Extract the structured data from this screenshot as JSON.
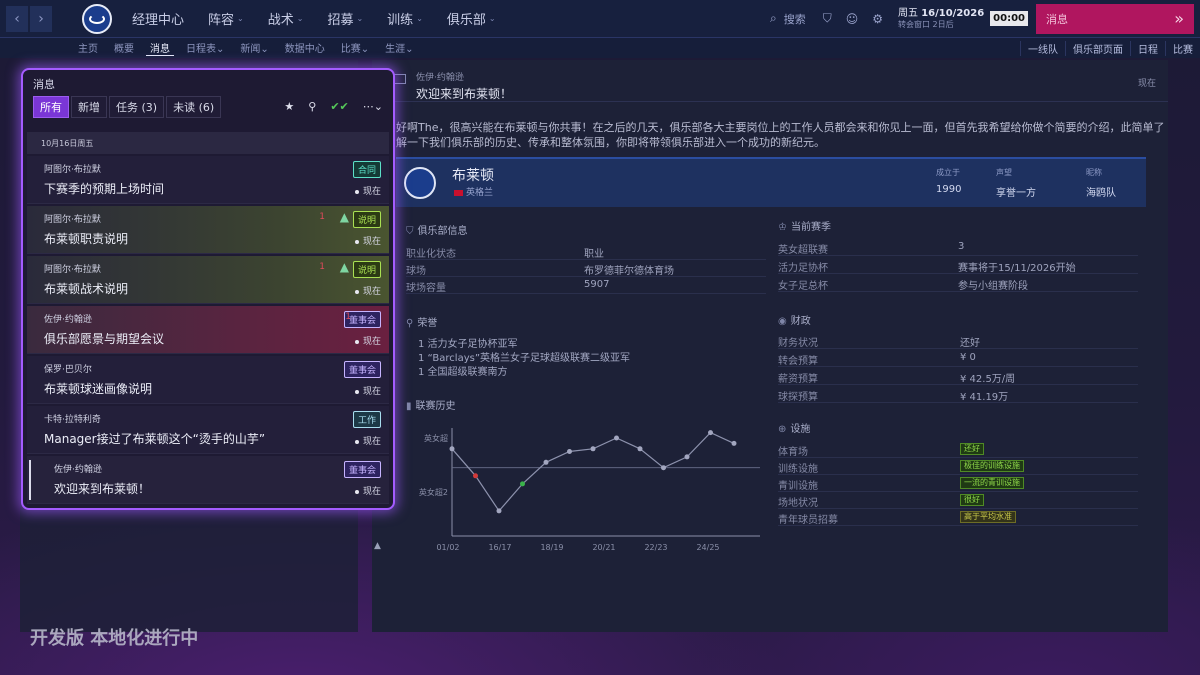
{
  "topnav": {
    "items": [
      "经理中心",
      "阵容",
      "战术",
      "招募",
      "训练",
      "俱乐部"
    ],
    "search_label": "搜索",
    "date_line": "周五",
    "date_value": "16/10/2026",
    "date_sub": "转会窗口",
    "date_sub2": "2日后",
    "time": "00:00",
    "continue_label": "消息"
  },
  "subnav": {
    "items": [
      "主页",
      "概要",
      "消息",
      "日程表",
      "新闻",
      "数据中心",
      "比赛",
      "生涯"
    ],
    "active_index": 2,
    "dropdown_flags": [
      false,
      false,
      false,
      true,
      true,
      false,
      true,
      true
    ],
    "right": [
      "一线队",
      "俱乐部页面",
      "日程",
      "比赛"
    ]
  },
  "inbox": {
    "title": "消息",
    "filters": [
      "所有",
      "新增",
      "任务 (3)",
      "未读 (6)"
    ],
    "date_header": "10月16日周五",
    "messages": [
      {
        "sender": "阿图尔·布拉默",
        "subject": "下赛季的预期上场时间",
        "tag": "合同",
        "time": "现在",
        "style": "plain",
        "tagclass": "t-contract"
      },
      {
        "sender": "阿图尔·布拉默",
        "subject": "布莱顿职责说明",
        "tag": "说明",
        "time": "现在",
        "style": "green",
        "tagclass": "t-explain",
        "badge": "1",
        "cap": true
      },
      {
        "sender": "阿图尔·布拉默",
        "subject": "布莱顿战术说明",
        "tag": "说明",
        "time": "现在",
        "style": "green",
        "tagclass": "t-explain",
        "badge": "1",
        "cap": true
      },
      {
        "sender": "佐伊·约翰逊",
        "subject": "俱乐部愿景与期望会议",
        "tag": "董事会",
        "time": "现在",
        "style": "red",
        "tagclass": "t-board",
        "badge": "1"
      },
      {
        "sender": "保罗·巴贝尔",
        "subject": "布莱顿球迷画像说明",
        "tag": "董事会",
        "time": "现在",
        "style": "plain",
        "tagclass": "t-board"
      },
      {
        "sender": "卡特·拉特利奇",
        "subject": "Manager接过了布莱顿这个“烫手的山芋”",
        "tag": "工作",
        "time": "现在",
        "style": "plain",
        "tagclass": "t-work"
      },
      {
        "sender": "佐伊·约翰逊",
        "subject": "欢迎来到布莱顿！",
        "tag": "董事会",
        "time": "现在",
        "style": "sel",
        "tagclass": "t-board"
      }
    ]
  },
  "detail": {
    "from": "佐伊·约翰逊",
    "subject": "欢迎来到布莱顿！",
    "when": "现在",
    "greeting": "好啊The，很高兴能在布莱顿与你共事！在之后的几天，俱乐部各大主要岗位上的工作人员都会来和你见上一面，但首先我希望给你做个简要的介绍，此简单了解一下我们俱乐部的历史、传承和整体氛围，你即将带领俱乐部进入一个成功的新纪元。",
    "club": {
      "name": "布莱顿",
      "country": "英格兰",
      "founded_label": "成立于",
      "founded": "1990",
      "rep_label": "声望",
      "rep": "享誉一方",
      "nick_label": "昵称",
      "nick": "海鸥队"
    },
    "club_info": {
      "title": "俱乐部信息",
      "rows": [
        [
          "职业化状态",
          "职业"
        ],
        [
          "球场",
          "布罗德菲尔德体育场"
        ],
        [
          "球场容量",
          "5907"
        ]
      ]
    },
    "honours": {
      "title": "荣誉",
      "rows": [
        "1 活力女子足协杯亚军",
        "1 “Barclays”英格兰女子足球超级联赛二级亚军",
        "1 全国超级联赛南方"
      ]
    },
    "history_title": "联赛历史",
    "season": {
      "title": "当前赛季",
      "rows": [
        [
          "英女超联赛",
          "3"
        ],
        [
          "活力足协杯",
          "赛事将于15/11/2026开始"
        ],
        [
          "女子足总杯",
          "参与小组赛阶段"
        ]
      ]
    },
    "finance": {
      "title": "财政",
      "rows": [
        [
          "财务状况",
          "还好"
        ],
        [
          "转会预算",
          "¥ 0"
        ],
        [
          "薪资预算",
          "¥ 42.5万/周"
        ],
        [
          "球探预算",
          "¥ 41.19万"
        ]
      ]
    },
    "facilities": {
      "title": "设施",
      "rows": [
        [
          "体育场",
          "还好",
          "good"
        ],
        [
          "训练设施",
          "极佳的训练设施",
          "good"
        ],
        [
          "青训设施",
          "一流的青训设施",
          "good"
        ],
        [
          "场地状况",
          "很好",
          "good"
        ],
        [
          "青年球员招募",
          "高于平均水准",
          "avg"
        ]
      ]
    }
  },
  "chart_data": {
    "type": "line",
    "x": [
      "01/02",
      "16/17",
      "18/19",
      "20/21",
      "22/23",
      "24/25"
    ],
    "y_tick_labels": [
      "英女超",
      "英女超2"
    ],
    "values": [
      1.2,
      1.7,
      2.35,
      1.85,
      1.45,
      1.25,
      1.2,
      1.0,
      1.2,
      1.55,
      1.35,
      0.9,
      1.1
    ]
  },
  "watermark": "开发版 本地化进行中"
}
